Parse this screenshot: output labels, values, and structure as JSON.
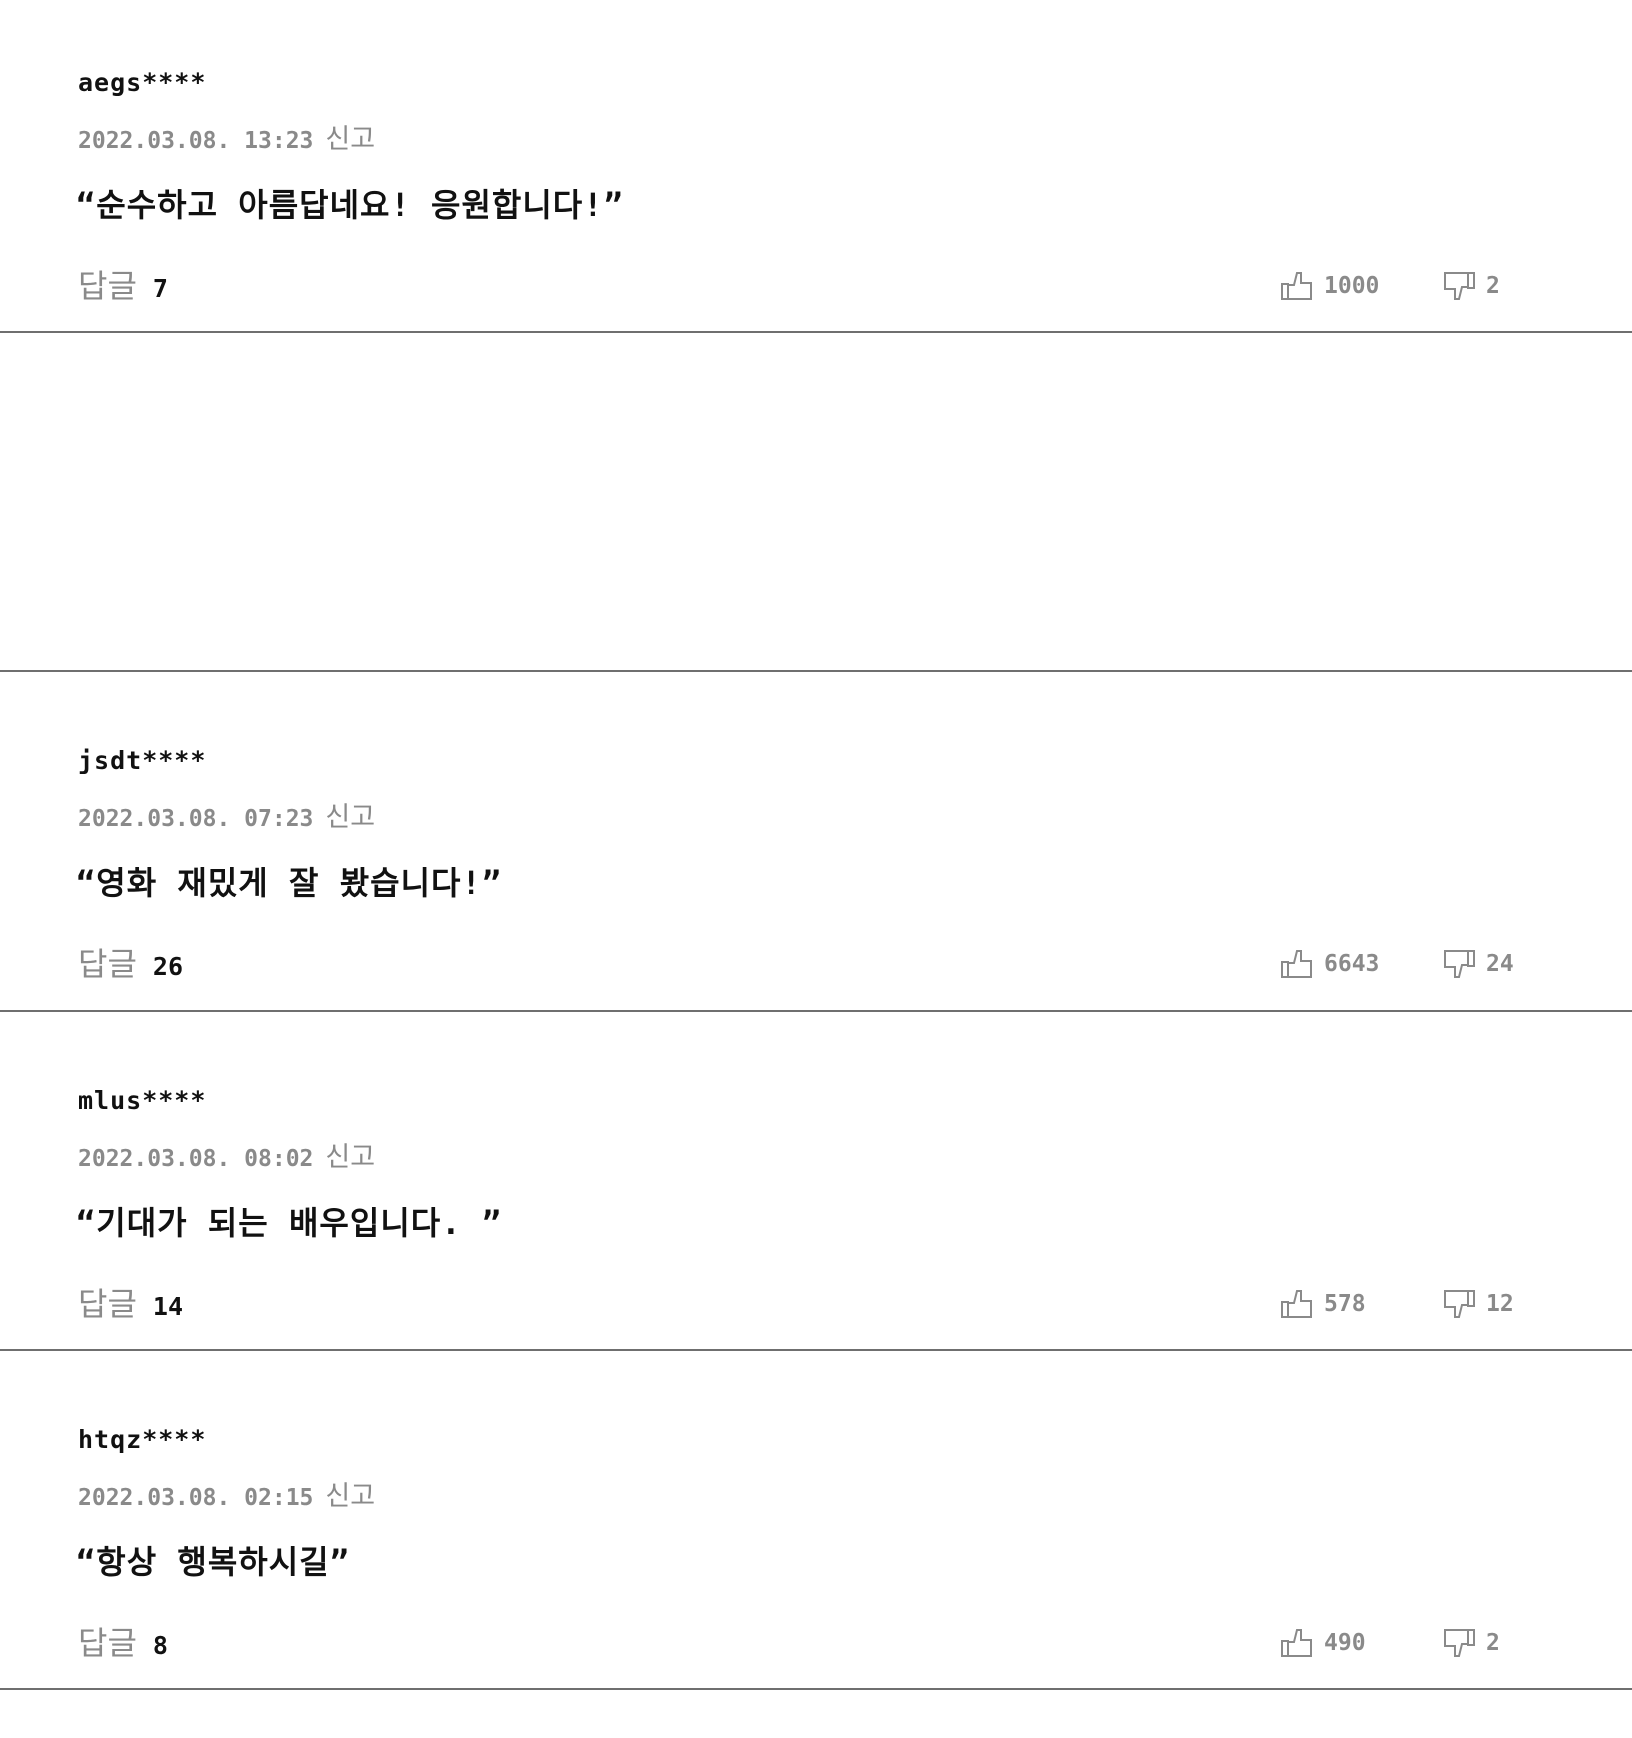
{
  "comments": [
    {
      "username": "aegs****",
      "datetime": "2022.03.08. 13:23",
      "report_label": "신고",
      "content": "“순수하고 아름답네요! 응원합니다!”",
      "reply_label": "답글",
      "reply_count": "7",
      "likes": "1000",
      "dislikes": "2"
    },
    {
      "username": "jsdt****",
      "datetime": "2022.03.08. 07:23",
      "report_label": "신고",
      "content": "“영화 재밌게 잘 봤습니다!”",
      "reply_label": "답글",
      "reply_count": "26",
      "likes": "6643",
      "dislikes": "24"
    },
    {
      "username": "mlus****",
      "datetime": "2022.03.08. 08:02",
      "report_label": "신고",
      "content": "“기대가 되는 배우입니다. ”",
      "reply_label": "답글",
      "reply_count": "14",
      "likes": "578",
      "dislikes": "12"
    },
    {
      "username": "htqz****",
      "datetime": "2022.03.08. 02:15",
      "report_label": "신고",
      "content": "“항상 행복하시길”",
      "reply_label": "답글",
      "reply_count": "8",
      "likes": "490",
      "dislikes": "2"
    }
  ],
  "icons": {
    "like": "thumbs-up-icon",
    "dislike": "thumbs-down-icon"
  },
  "colors": {
    "text": "#111111",
    "muted": "#8a8a8a",
    "divider": "#6f6f6f"
  }
}
